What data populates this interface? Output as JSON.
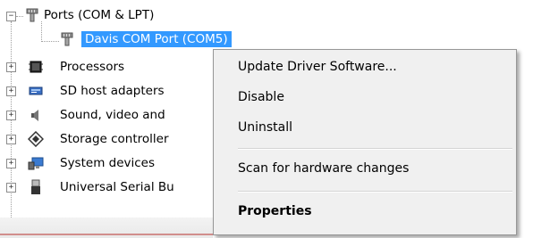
{
  "tree": {
    "ports_label": "Ports (COM & LPT)",
    "davis_label": "Davis COM Port (COM5)",
    "items": [
      {
        "label": "Processors",
        "icon": "processor-icon"
      },
      {
        "label": "SD host adapters",
        "icon": "sd-adapter-icon"
      },
      {
        "label": "Sound, video and",
        "icon": "speaker-icon"
      },
      {
        "label": "Storage controller",
        "icon": "storage-controller-icon"
      },
      {
        "label": "System devices",
        "icon": "system-devices-icon"
      },
      {
        "label": "Universal Serial Bu",
        "icon": "usb-icon"
      }
    ]
  },
  "context_menu": {
    "update": "Update Driver Software...",
    "disable": "Disable",
    "uninstall": "Uninstall",
    "scan": "Scan for hardware changes",
    "properties": "Properties"
  },
  "colors": {
    "selection": "#3399ff",
    "menu_bg": "#f0f0f0"
  }
}
